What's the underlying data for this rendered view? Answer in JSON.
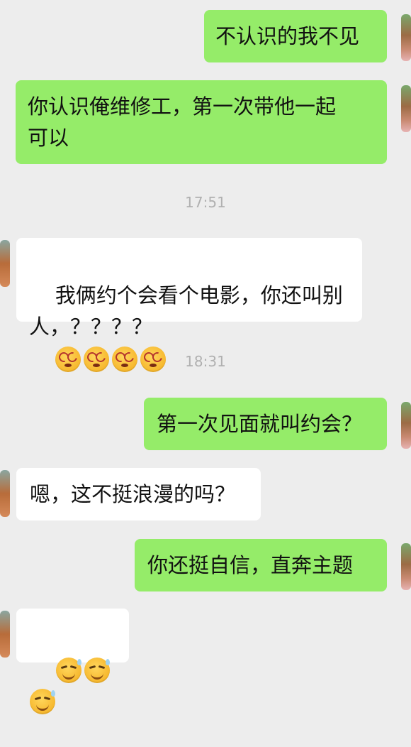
{
  "chat": {
    "messages": [
      {
        "id": "m1",
        "side": "out",
        "text": "不认识的我不见"
      },
      {
        "id": "m2",
        "side": "out",
        "text": "你认识俺维修工，第一次带他一起\n可以"
      },
      {
        "id": "t1",
        "type": "timestamp",
        "text": "17:51"
      },
      {
        "id": "m3",
        "side": "in",
        "text": "我俩约个会看个电影，你还叫别\n人，？？？？",
        "emoji": [
          "dizzy-face-icon",
          "dizzy-face-icon",
          "dizzy-face-icon",
          "dizzy-face-icon"
        ]
      },
      {
        "id": "t2",
        "type": "timestamp",
        "text": "18:31"
      },
      {
        "id": "m4",
        "side": "out",
        "text": "第一次见面就叫约会？"
      },
      {
        "id": "m5",
        "side": "in",
        "text": "嗯，这不挺浪漫的吗？"
      },
      {
        "id": "m6",
        "side": "out",
        "text": "你还挺自信，直奔主题"
      },
      {
        "id": "m7",
        "side": "in",
        "text": "",
        "emoji": [
          "awkward-sweat-smile-icon",
          "awkward-sweat-smile-icon",
          "awkward-sweat-smile-icon"
        ]
      }
    ]
  },
  "colors": {
    "background": "#ededed",
    "outgoing_bubble": "#95ec69",
    "incoming_bubble": "#ffffff",
    "timestamp_text": "#b0b0b0"
  }
}
